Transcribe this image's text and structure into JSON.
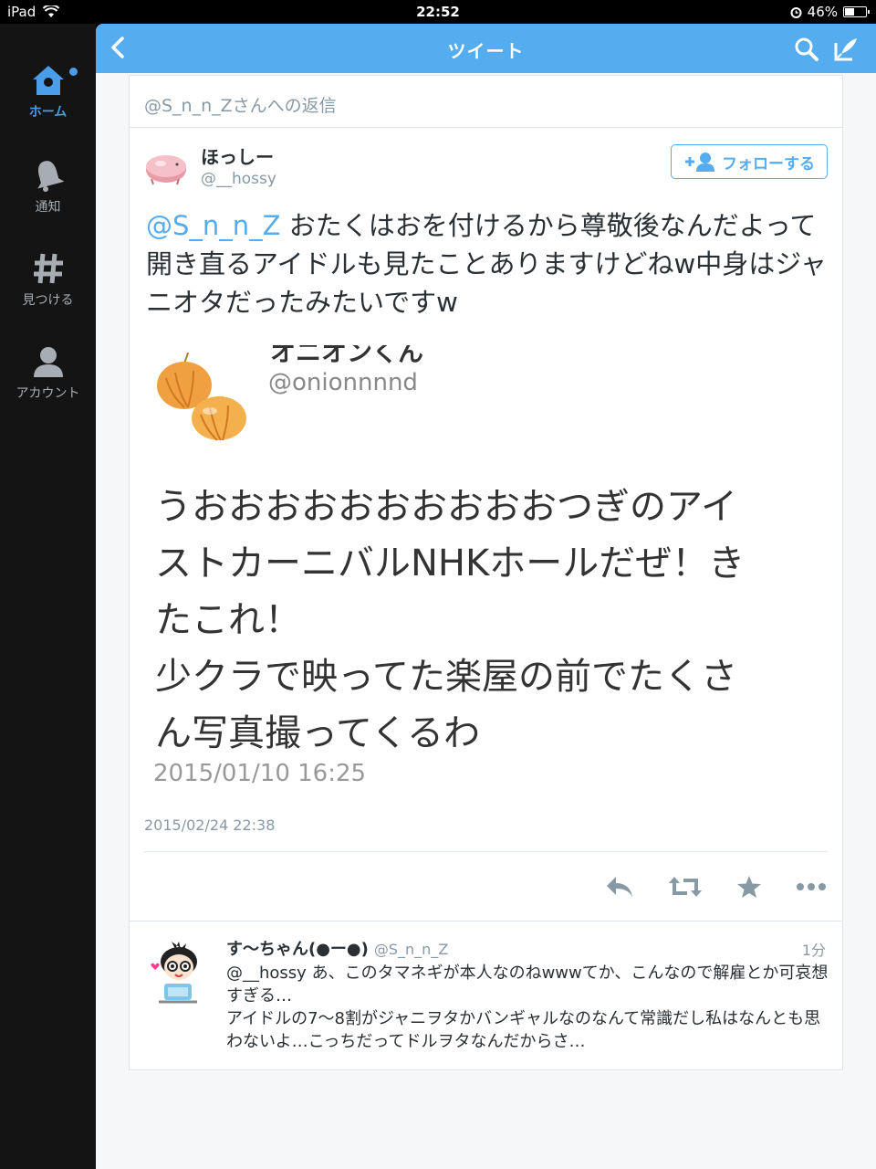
{
  "status_bar": {
    "device": "iPad",
    "time": "22:52",
    "battery": "46%",
    "battery_level": 0.46
  },
  "sidebar": {
    "items": [
      {
        "label": "ホーム",
        "icon": "home-icon",
        "active": true
      },
      {
        "label": "通知",
        "icon": "bell-icon"
      },
      {
        "label": "見つける",
        "icon": "hashtag-icon"
      },
      {
        "label": "アカウント",
        "icon": "person-icon"
      }
    ]
  },
  "navbar": {
    "title": "ツイート"
  },
  "reply_header": "@S_n_n_Zさんへの返信",
  "tweet": {
    "name": "ほっしー",
    "handle": "@__hossy",
    "follow_label": "フォローする",
    "mention": "@S_n_n_Z",
    "text": " おたくはおを付けるから尊敬後なんだよって開き直るアイドルも見たことありますけどねw中身はジャニオタだったみたいですw",
    "date": "2015/02/24 22:38",
    "embedded": {
      "name_partial": "オニオンくん",
      "handle": "@onionnnnd",
      "text_lines": [
        "うおおおおおおおおおおつぎのアイ",
        "ストカーニバルNHKホールだぜ！き",
        "たこれ！",
        "少クラで映ってた楽屋の前でたくさ",
        "ん写真撮ってくるわ"
      ],
      "date": "2015/01/10 16:25"
    }
  },
  "reply": {
    "name": "す〜ちゃん(●ー●)",
    "handle": "@S_n_n_Z",
    "time": "1分",
    "mention": "@__hossy",
    "text": " あ、このタマネギが本人なのねwwwてか、こんなので解雇とか可哀想すぎる…",
    "text2": "アイドルの7〜8割がジャニヲタかバンギャルなのなんて常識だし私はなんとも思わないよ…こっちだってドルヲタなんだからさ…"
  },
  "colors": {
    "accent": "#55acee",
    "sidebar_bg": "#141414"
  }
}
